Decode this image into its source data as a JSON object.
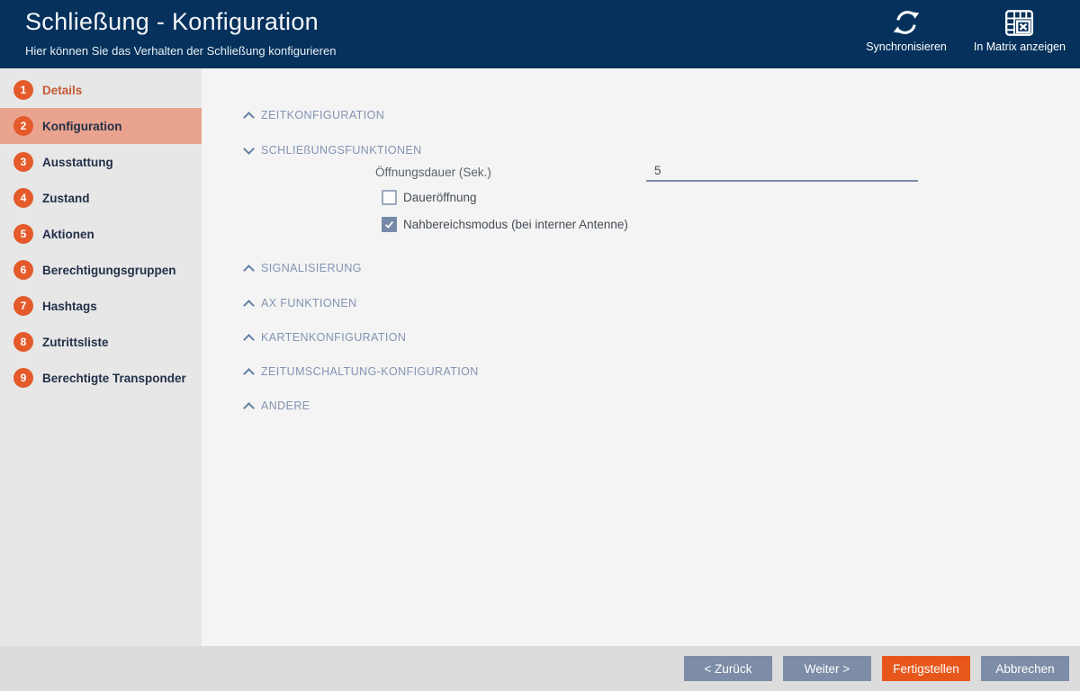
{
  "header": {
    "title": "Schließung - Konfiguration",
    "subtitle": "Hier können Sie das Verhalten der Schließung konfigurieren",
    "actions": [
      {
        "label": "Synchronisieren",
        "icon": "sync-icon"
      },
      {
        "label": "In Matrix anzeigen",
        "icon": "matrix-icon"
      }
    ]
  },
  "sidebar": {
    "items": [
      {
        "number": "1",
        "label": "Details",
        "state": "completed"
      },
      {
        "number": "2",
        "label": "Konfiguration",
        "state": "active"
      },
      {
        "number": "3",
        "label": "Ausstattung",
        "state": "default"
      },
      {
        "number": "4",
        "label": "Zustand",
        "state": "default"
      },
      {
        "number": "5",
        "label": "Aktionen",
        "state": "default"
      },
      {
        "number": "6",
        "label": "Berechtigungsgruppen",
        "state": "default"
      },
      {
        "number": "7",
        "label": "Hashtags",
        "state": "default"
      },
      {
        "number": "8",
        "label": "Zutrittsliste",
        "state": "default"
      },
      {
        "number": "9",
        "label": "Berechtigte Transponder",
        "state": "default"
      }
    ]
  },
  "main": {
    "sections": [
      {
        "label": "ZEITKONFIGURATION",
        "state": "collapsed"
      },
      {
        "label": "SCHLIEßUNGSFUNKTIONEN",
        "state": "expanded"
      },
      {
        "label": "SIGNALISIERUNG",
        "state": "collapsed"
      },
      {
        "label": "AX FUNKTIONEN",
        "state": "collapsed"
      },
      {
        "label": "KARTENKONFIGURATION",
        "state": "collapsed"
      },
      {
        "label": "ZEITUMSCHALTUNG-KONFIGURATION",
        "state": "collapsed"
      },
      {
        "label": "ANDERE",
        "state": "collapsed"
      }
    ],
    "form": {
      "oeffnungsdauer_label": "Öffnungsdauer (Sek.)",
      "oeffnungsdauer_value": "5",
      "daueroeffnung_label": "Daueröffnung",
      "daueroeffnung_checked": false,
      "nahbereich_label": "Nahbereichsmodus (bei interner Antenne)",
      "nahbereich_checked": true
    }
  },
  "footer": {
    "buttons": [
      {
        "label": "< Zurück",
        "type": "secondary"
      },
      {
        "label": "Weiter >",
        "type": "secondary"
      },
      {
        "label": "Fertigstellen",
        "type": "primary"
      },
      {
        "label": "Abbrechen",
        "type": "secondary"
      }
    ]
  },
  "colors": {
    "header_bg": "#05315c",
    "accent_orange": "#e45a2b",
    "primary_button_orange": "#e7571c",
    "active_step_salmon": "#eaa38e",
    "completed_step_text": "#c25b36",
    "secondary_button_slate": "#7d8ca7",
    "section_header_blue": "#8294b2",
    "sidebar_bg": "#e7e7e7",
    "main_bg": "#f4f4f4",
    "footer_bg": "#dcdcdc"
  }
}
